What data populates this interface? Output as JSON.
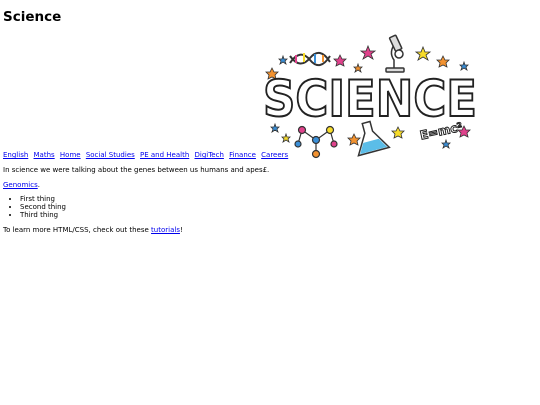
{
  "page": {
    "title": "Science"
  },
  "banner": {
    "word": "SCIENCE",
    "formula": "E=mc²"
  },
  "nav": {
    "links": [
      "English",
      "Maths",
      "Home",
      "Social Studies",
      "PE and Health",
      "DigiTech",
      "Finance",
      "Careers"
    ]
  },
  "content": {
    "intro": "In science we were talking about the genes between us humans and apes£.",
    "genomics_link": "Genomics",
    "genomics_suffix": ".",
    "list_items": [
      "First thing",
      "Second thing",
      "Third thing"
    ],
    "outro_prefix": "To learn more HTML/CSS, check out these ",
    "outro_link": "tutorials",
    "outro_suffix": "!"
  },
  "colors": {
    "link": "#0000ee",
    "star_yellow": "#f7dc2b",
    "star_pink": "#e0428c",
    "star_blue": "#3a8fd8",
    "star_orange": "#f29230",
    "flask_liquid": "#5bbde8"
  }
}
